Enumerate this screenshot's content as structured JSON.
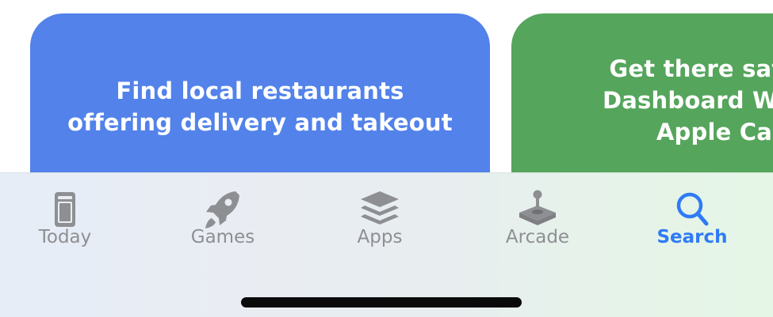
{
  "cards": [
    {
      "lines": [
        "Find local restaurants",
        "offering delivery and takeout"
      ],
      "color": "#5282ea"
    },
    {
      "lines": [
        "Get there safely with",
        "Dashboard Wallet and",
        "Apple CarPlay"
      ],
      "color": "#55a55c"
    }
  ],
  "tabs": [
    {
      "label": "Today",
      "icon": "today-icon",
      "active": false
    },
    {
      "label": "Games",
      "icon": "rocket-icon",
      "active": false
    },
    {
      "label": "Apps",
      "icon": "layers-icon",
      "active": false
    },
    {
      "label": "Arcade",
      "icon": "joystick-icon",
      "active": false
    },
    {
      "label": "Search",
      "icon": "search-icon",
      "active": true
    }
  ],
  "colors": {
    "active_tab": "#2f7bf5",
    "inactive_tab": "#8e8f93"
  }
}
